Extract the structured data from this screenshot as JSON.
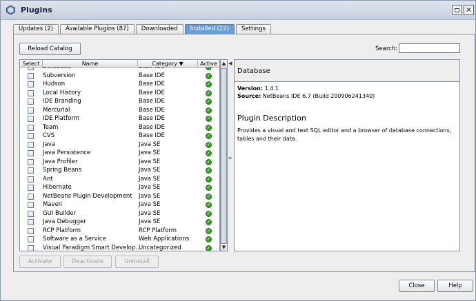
{
  "window": {
    "title": "Plugins"
  },
  "tabs": [
    {
      "label": "Updates (2)",
      "active": false
    },
    {
      "label": "Available Plugins (87)",
      "active": false
    },
    {
      "label": "Downloaded",
      "active": false
    },
    {
      "label": "Installed (22)",
      "active": true
    },
    {
      "label": "Settings",
      "active": false
    }
  ],
  "toolbar": {
    "reload_label": "Reload Catalog"
  },
  "search": {
    "label": "Search:",
    "value": "",
    "placeholder": ""
  },
  "table": {
    "columns": {
      "select": "Select",
      "name": "Name",
      "category": "Category ▼",
      "active": "Active"
    },
    "rows": [
      {
        "name": "Database",
        "category": "Base IDE"
      },
      {
        "name": "Subversion",
        "category": "Base IDE"
      },
      {
        "name": "Hudson",
        "category": "Base IDE"
      },
      {
        "name": "Local History",
        "category": "Base IDE"
      },
      {
        "name": "IDE Branding",
        "category": "Base IDE"
      },
      {
        "name": "Mercurial",
        "category": "Base IDE"
      },
      {
        "name": "IDE Platform",
        "category": "Base IDE"
      },
      {
        "name": "Team",
        "category": "Base IDE"
      },
      {
        "name": "CVS",
        "category": "Base IDE"
      },
      {
        "name": "Java",
        "category": "Java SE"
      },
      {
        "name": "Java Persistence",
        "category": "Java SE"
      },
      {
        "name": "Java Profiler",
        "category": "Java SE"
      },
      {
        "name": "Spring Beans",
        "category": "Java SE"
      },
      {
        "name": "Ant",
        "category": "Java SE"
      },
      {
        "name": "Hibernate",
        "category": "Java SE"
      },
      {
        "name": "NetBeans Plugin Development",
        "category": "Java SE"
      },
      {
        "name": "Maven",
        "category": "Java SE"
      },
      {
        "name": "GUI Builder",
        "category": "Java SE"
      },
      {
        "name": "Java Debugger",
        "category": "Java SE"
      },
      {
        "name": "RCP Platform",
        "category": "RCP Platform"
      },
      {
        "name": "Software as a Service",
        "category": "Web Applications"
      },
      {
        "name": "Visual Paradigm Smart Develop...",
        "category": "Uncategorized"
      }
    ]
  },
  "details": {
    "title": "Database",
    "version_label": "Version:",
    "version": "1.4.1",
    "source_label": "Source:",
    "source": "NetBeans IDE 6.7 (Build 200906241340)",
    "description_heading": "Plugin Description",
    "description": "Provides a visual and text SQL editor and a browser of database connections, tables and their data."
  },
  "actions": {
    "activate": "Activate",
    "deactivate": "Deactivate",
    "uninstall": "Uninstall"
  },
  "footer": {
    "close": "Close",
    "help": "Help"
  },
  "colors": {
    "active_tab": "#6b9ed6",
    "active_icon": "#3b9a2e"
  },
  "icons": {
    "window": "netbeans-plugins-icon",
    "active": "check-circle-icon",
    "restore": "restore-icon",
    "close": "close-icon"
  }
}
